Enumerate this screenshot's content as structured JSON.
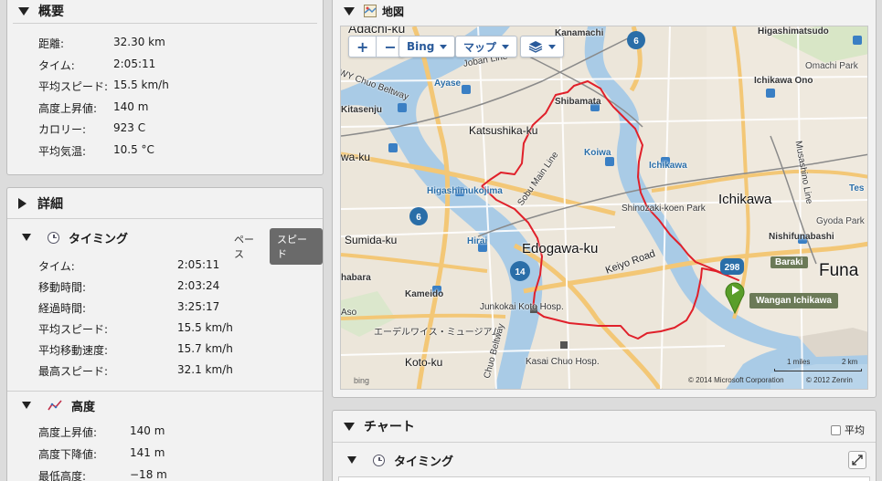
{
  "summary": {
    "title": "概要",
    "rows": [
      {
        "label": "距離:",
        "value": "32.30 km"
      },
      {
        "label": "タイム:",
        "value": "2:05:11"
      },
      {
        "label": "平均スピード:",
        "value": "15.5 km/h"
      },
      {
        "label": "高度上昇値:",
        "value": "140 m"
      },
      {
        "label": "カロリー:",
        "value": "923 C"
      },
      {
        "label": "平均気温:",
        "value": "10.5 °C"
      }
    ]
  },
  "details": {
    "title": "詳細",
    "timing": {
      "title": "タイミング",
      "seg_base": "ペース",
      "seg_speed": "スピード",
      "rows": [
        {
          "label": "タイム:",
          "value": "2:05:11"
        },
        {
          "label": "移動時間:",
          "value": "2:03:24"
        },
        {
          "label": "経過時間:",
          "value": "3:25:17"
        },
        {
          "label": "平均スピード:",
          "value": "15.5 km/h"
        },
        {
          "label": "平均移動速度:",
          "value": "15.7 km/h"
        },
        {
          "label": "最高スピード:",
          "value": "32.1 km/h"
        }
      ]
    },
    "elevation": {
      "title": "高度",
      "rows": [
        {
          "label": "高度上昇値:",
          "value": "140 m"
        },
        {
          "label": "高度下降値:",
          "value": "141 m"
        },
        {
          "label": "最低高度:",
          "value": "−18 m"
        }
      ]
    }
  },
  "map": {
    "title": "地図",
    "bing_label": "Bing",
    "maptype_label": "マップ",
    "zoom_in": "+",
    "zoom_out": "−",
    "marker_label": "Wangan Ichikawa",
    "copyright1": "© 2014 Microsoft Corporation",
    "copyright2": "© 2012 Zenrin",
    "scale_miles": "1 miles",
    "scale_km": "2 km",
    "bing_logo": "bing",
    "places": [
      {
        "text": "Adachi-ku",
        "key": "adachi"
      },
      {
        "text": "Kanamachi",
        "key": "kanamachi"
      },
      {
        "text": "Higashimatsudo",
        "key": "higashimatsudo"
      },
      {
        "text": "Omachi Park",
        "key": "omachi"
      },
      {
        "text": "WY Chuo Beltway",
        "key": "chuobeltway"
      },
      {
        "text": "Joban Line",
        "key": "joban"
      },
      {
        "text": "Ayase",
        "key": "ayase"
      },
      {
        "text": "Shibamata",
        "key": "shibamata"
      },
      {
        "text": "Ichikawa Ono",
        "key": "ichikawaono"
      },
      {
        "text": "Kitasenju",
        "key": "kitasenju"
      },
      {
        "text": "Katsushika-ku",
        "key": "katsushika"
      },
      {
        "text": "Koiwa",
        "key": "koiwa"
      },
      {
        "text": "Ichikawa",
        "key": "ichikawa_st"
      },
      {
        "text": "Musashino Line",
        "key": "musashino"
      },
      {
        "text": "wa-ku",
        "key": "waku"
      },
      {
        "text": "Higashimukojima",
        "key": "higashimukojima"
      },
      {
        "text": "Sobu Main Line",
        "key": "sobu"
      },
      {
        "text": "Ichikawa",
        "key": "ichikawa_big"
      },
      {
        "text": "Shinozaki-koen Park",
        "key": "shinozaki"
      },
      {
        "text": "Gyoda Park",
        "key": "gyoda"
      },
      {
        "text": "Sumida-ku",
        "key": "sumida"
      },
      {
        "text": "Hirai",
        "key": "hirai"
      },
      {
        "text": "Edogawa-ku",
        "key": "edogawa"
      },
      {
        "text": "Nishifunabashi",
        "key": "nishifunabashi"
      },
      {
        "text": "Baraki",
        "key": "baraki"
      },
      {
        "text": "Funa",
        "key": "funa"
      },
      {
        "text": "habara",
        "key": "habara"
      },
      {
        "text": "Keiyo Road",
        "key": "keiyo"
      },
      {
        "text": "Kameido",
        "key": "kameido"
      },
      {
        "text": "Junkokai Koto Hosp.",
        "key": "junkokai"
      },
      {
        "text": "Aso",
        "key": "aso"
      },
      {
        "text": "エーデルワイス・ミュージアム",
        "key": "edelweiss"
      },
      {
        "text": "Koto-ku",
        "key": "koto"
      },
      {
        "text": "Chuo Beltway",
        "key": "chuobelt2"
      },
      {
        "text": "Kasai Chuo Hosp.",
        "key": "kasai"
      },
      {
        "text": "Tes",
        "key": "tes"
      }
    ],
    "route_shields": [
      "6",
      "6",
      "14",
      "298"
    ]
  },
  "chart": {
    "title": "チャート",
    "avg_label": "平均",
    "timing_title": "タイミング"
  },
  "colors": {
    "route": "#e0202a",
    "water": "#a9cbe6",
    "road_major": "#f3c776",
    "marker": "#5a9e2a"
  }
}
